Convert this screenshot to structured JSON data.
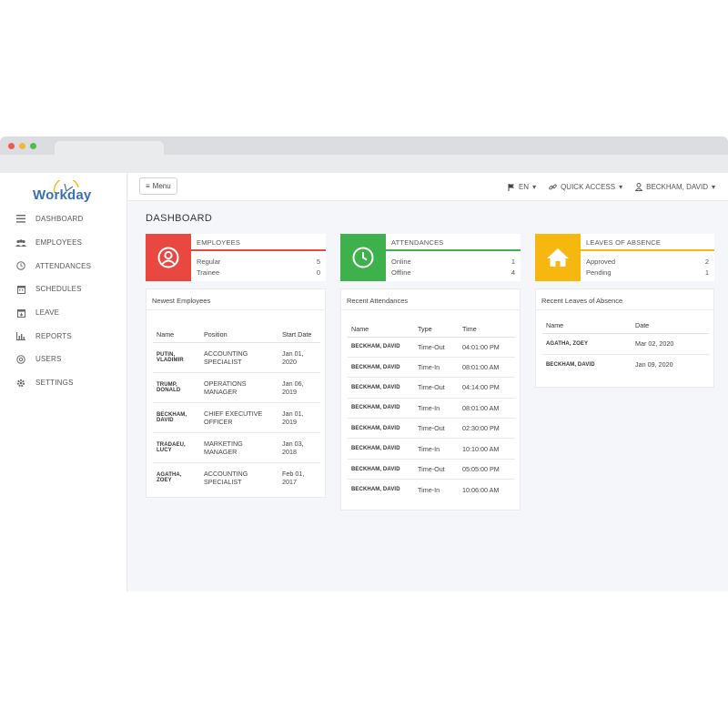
{
  "colors": {
    "red": "#e8483f",
    "green": "#3eb14d",
    "yellow": "#f6b70e",
    "brand": "#3b6fb4"
  },
  "logo": {
    "text": "Workday"
  },
  "sidebar": {
    "items": [
      {
        "label": "DASHBOARD",
        "icon": "list-icon"
      },
      {
        "label": "EMPLOYEES",
        "icon": "users-icon"
      },
      {
        "label": "ATTENDANCES",
        "icon": "clock-icon"
      },
      {
        "label": "SCHEDULES",
        "icon": "calendar-icon"
      },
      {
        "label": "LEAVE",
        "icon": "calendar-leave-icon"
      },
      {
        "label": "REPORTS",
        "icon": "bar-chart-icon"
      },
      {
        "label": "USERS",
        "icon": "at-icon"
      },
      {
        "label": "SETTINGS",
        "icon": "gear-icon"
      }
    ]
  },
  "topbar": {
    "menu_label": "Menu",
    "language": "EN",
    "quick_access": "QUICK ACCESS",
    "user": "BECKHAM, DAVID"
  },
  "page": {
    "title": "DASHBOARD"
  },
  "stats": {
    "employees": {
      "title": "EMPLOYEES",
      "rows": [
        {
          "label": "Regular",
          "value": "5"
        },
        {
          "label": "Trainee",
          "value": "0"
        }
      ]
    },
    "attendances": {
      "title": "ATTENDANCES",
      "rows": [
        {
          "label": "Online",
          "value": "1"
        },
        {
          "label": "Offline",
          "value": "4"
        }
      ]
    },
    "leaves": {
      "title": "LEAVES OF ABSENCE",
      "rows": [
        {
          "label": "Approved",
          "value": "2"
        },
        {
          "label": "Pending",
          "value": "1"
        }
      ]
    }
  },
  "newest_employees": {
    "title": "Newest Employees",
    "headers": [
      "Name",
      "Position",
      "Start Date"
    ],
    "rows": [
      [
        "PUTIN, VLADIMIR",
        "ACCOUNTING SPECIALIST",
        "Jan 01, 2020"
      ],
      [
        "TRUMP, DONALD",
        "OPERATIONS MANAGER",
        "Jan 06, 2019"
      ],
      [
        "BECKHAM, DAVID",
        "CHIEF EXECUTIVE OFFICER",
        "Jan 01, 2019"
      ],
      [
        "TRADAEU, LUCY",
        "MARKETING MANAGER",
        "Jan 03, 2018"
      ],
      [
        "AGATHA, ZOEY",
        "ACCOUNTING SPECIALIST",
        "Feb 01, 2017"
      ]
    ]
  },
  "recent_attendances": {
    "title": "Recent Attendances",
    "headers": [
      "Name",
      "Type",
      "Time"
    ],
    "rows": [
      [
        "BECKHAM, DAVID",
        "Time-Out",
        "04:01:00 PM"
      ],
      [
        "BECKHAM, DAVID",
        "Time-In",
        "08:01:00 AM"
      ],
      [
        "BECKHAM, DAVID",
        "Time-Out",
        "04:14:00 PM"
      ],
      [
        "BECKHAM, DAVID",
        "Time-In",
        "08:01:00 AM"
      ],
      [
        "BECKHAM, DAVID",
        "Time-Out",
        "02:30:00 PM"
      ],
      [
        "BECKHAM, DAVID",
        "Time-In",
        "10:10:00 AM"
      ],
      [
        "BECKHAM, DAVID",
        "Time-Out",
        "05:05:00 PM"
      ],
      [
        "BECKHAM, DAVID",
        "Time-In",
        "10:06:00 AM"
      ]
    ]
  },
  "recent_leaves": {
    "title": "Recent Leaves of Absence",
    "headers": [
      "Name",
      "Date"
    ],
    "rows": [
      [
        "AGATHA, ZOEY",
        "Mar 02, 2020"
      ],
      [
        "BECKHAM, DAVID",
        "Jan 09, 2020"
      ]
    ]
  }
}
